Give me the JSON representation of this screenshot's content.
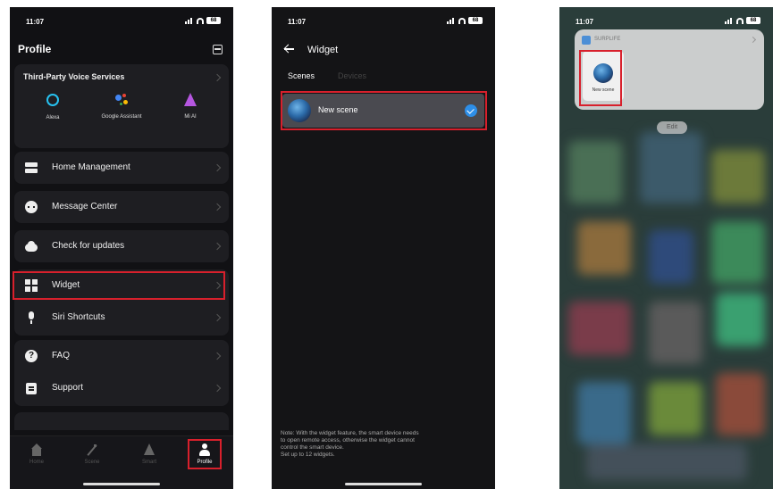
{
  "status": {
    "time": "11:07",
    "battery": "68"
  },
  "profile": {
    "title": "Profile",
    "voice": {
      "title": "Third-Party Voice Services",
      "items": [
        {
          "label": "Alexa",
          "icon": "alexa-icon"
        },
        {
          "label": "Google Assistant",
          "icon": "google-assistant-icon"
        },
        {
          "label": "Mi AI",
          "icon": "mi-ai-icon"
        }
      ]
    },
    "menu": {
      "home_management": "Home Management",
      "message_center": "Message Center",
      "check_updates": "Check for updates",
      "widget": "Widget",
      "siri_shortcuts": "Siri Shortcuts",
      "faq": "FAQ",
      "support": "Support"
    },
    "tabs": [
      "Home",
      "Scene",
      "Smart",
      "Profile"
    ],
    "active_tab": "Profile"
  },
  "widget_page": {
    "title": "Widget",
    "tabs": [
      "Scenes",
      "Devices"
    ],
    "selected_tab": "Scenes",
    "scene_name": "New scene",
    "note_lines": [
      "Note: With the widget feature, the smart device needs",
      "to open remote access, otherwise the widget cannot",
      "control the smart device.",
      "Set up to 12 widgets."
    ]
  },
  "home_widget": {
    "app_name": "SURPLIFE",
    "scene_name": "New scene",
    "edit_label": "Edit"
  },
  "colors": {
    "highlight": "#d8202c",
    "accent": "#2d8ee8",
    "background": "#111114"
  }
}
